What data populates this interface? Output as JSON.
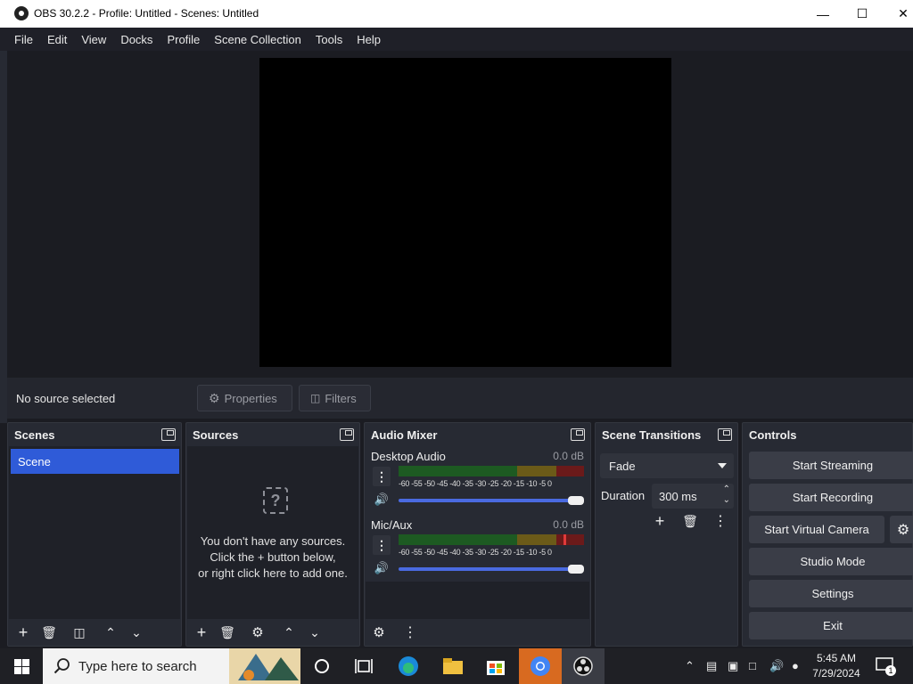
{
  "window": {
    "title": "OBS 30.2.2 - Profile: Untitled - Scenes: Untitled"
  },
  "menu": [
    "File",
    "Edit",
    "View",
    "Docks",
    "Profile",
    "Scene Collection",
    "Tools",
    "Help"
  ],
  "source_bar": {
    "status": "No source selected",
    "properties_label": "Properties",
    "filters_label": "Filters"
  },
  "scenes": {
    "title": "Scenes",
    "items": [
      "Scene"
    ]
  },
  "sources": {
    "title": "Sources",
    "empty_line1": "You don't have any sources.",
    "empty_line2": "Click the + button below,",
    "empty_line3": "or right click here to add one."
  },
  "audio_mixer": {
    "title": "Audio Mixer",
    "channels": [
      {
        "name": "Desktop Audio",
        "db": "0.0 dB",
        "volume": 1.0,
        "ticks": "-60 -55 -50 -45 -40 -35 -30 -25 -20 -15 -10 -5 0"
      },
      {
        "name": "Mic/Aux",
        "db": "0.0 dB",
        "volume": 1.0,
        "ticks": "-60 -55 -50 -45 -40 -35 -30 -25 -20 -15 -10 -5 0"
      }
    ]
  },
  "transitions": {
    "title": "Scene Transitions",
    "selected": "Fade",
    "duration_label": "Duration",
    "duration_value": "300 ms"
  },
  "controls": {
    "title": "Controls",
    "start_streaming": "Start Streaming",
    "start_recording": "Start Recording",
    "start_virtual_camera": "Start Virtual Camera",
    "studio_mode": "Studio Mode",
    "settings": "Settings",
    "exit": "Exit"
  },
  "taskbar": {
    "search_placeholder": "Type here to search",
    "time": "5:45 AM",
    "date": "7/29/2024",
    "notification_count": "1"
  },
  "colors": {
    "accent": "#2f5bd8",
    "panel": "#272a33",
    "background": "#1b1c22",
    "slider": "#4a6ae0"
  }
}
